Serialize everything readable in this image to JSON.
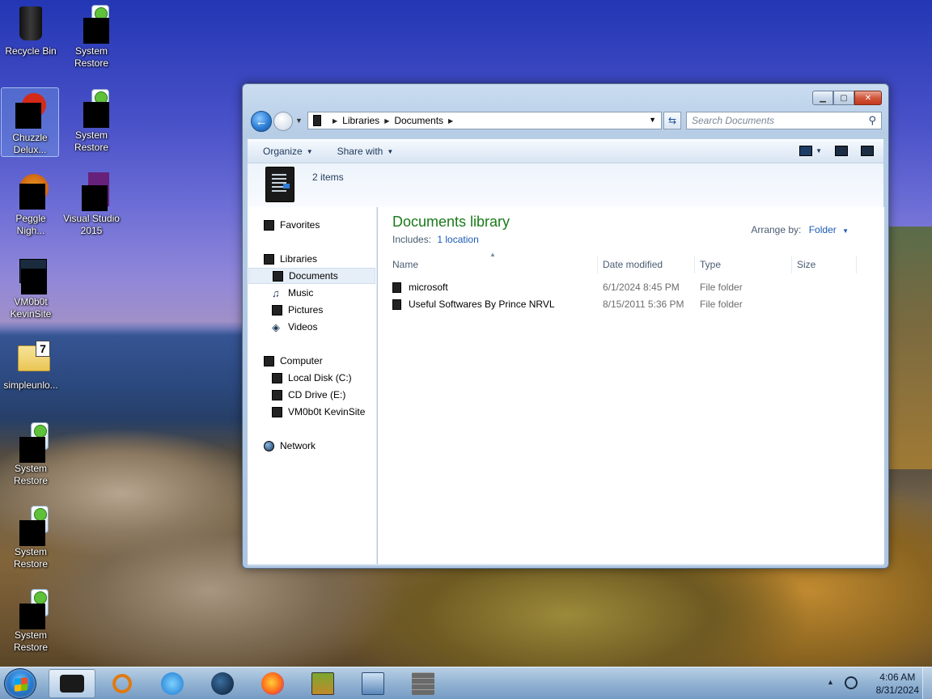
{
  "desktop": {
    "icons": [
      {
        "label": "Recycle Bin"
      },
      {
        "label": "System Restore"
      },
      {
        "label": "Chuzzle Delux..."
      },
      {
        "label": "System Restore"
      },
      {
        "label": "Peggle Nigh..."
      },
      {
        "label": "Visual Studio 2015"
      },
      {
        "label": "VM0b0t KevinSite"
      },
      {
        "label": "simpleunlo..."
      },
      {
        "label": "System Restore"
      },
      {
        "label": "System Restore"
      },
      {
        "label": "System Restore"
      }
    ]
  },
  "window": {
    "caption": {
      "min": "▁",
      "max": "▢",
      "close": "✕"
    },
    "address": {
      "crumbs": [
        "Libraries",
        "Documents"
      ]
    },
    "search": {
      "placeholder": "Search Documents"
    },
    "toolbar": {
      "organize": "Organize",
      "share_with": "Share with"
    },
    "details": {
      "items_count": "2 items"
    },
    "nav": {
      "favorites": "Favorites",
      "libraries": "Libraries",
      "documents": "Documents",
      "music": "Music",
      "pictures": "Pictures",
      "videos": "Videos",
      "computer": "Computer",
      "local_disk": "Local Disk (C:)",
      "cd_drive": "CD Drive (E:)",
      "vm_share": "VM0b0t KevinSite",
      "network": "Network"
    },
    "library": {
      "title": "Documents library",
      "includes_label": "Includes:",
      "includes_link": "1 location",
      "arrange_label": "Arrange by:",
      "arrange_value": "Folder"
    },
    "columns": {
      "name": "Name",
      "date": "Date modified",
      "type": "Type",
      "size": "Size"
    },
    "files": [
      {
        "name": "microsoft",
        "date": "6/1/2024 8:45 PM",
        "type": "File folder"
      },
      {
        "name": "Useful Softwares By Prince NRVL",
        "date": "8/15/2011 5:36 PM",
        "type": "File folder"
      }
    ]
  },
  "taskbar": {
    "apps": [
      "explorer",
      "search-app",
      "internet-explorer",
      "globe-browser",
      "firefox",
      "game-box",
      "network-monitor",
      "firewall"
    ],
    "clock": {
      "time": "4:06 AM",
      "date": "8/31/2024"
    }
  },
  "colors": {
    "library_title": "#1a7a1a",
    "link": "#1a5ab4"
  }
}
